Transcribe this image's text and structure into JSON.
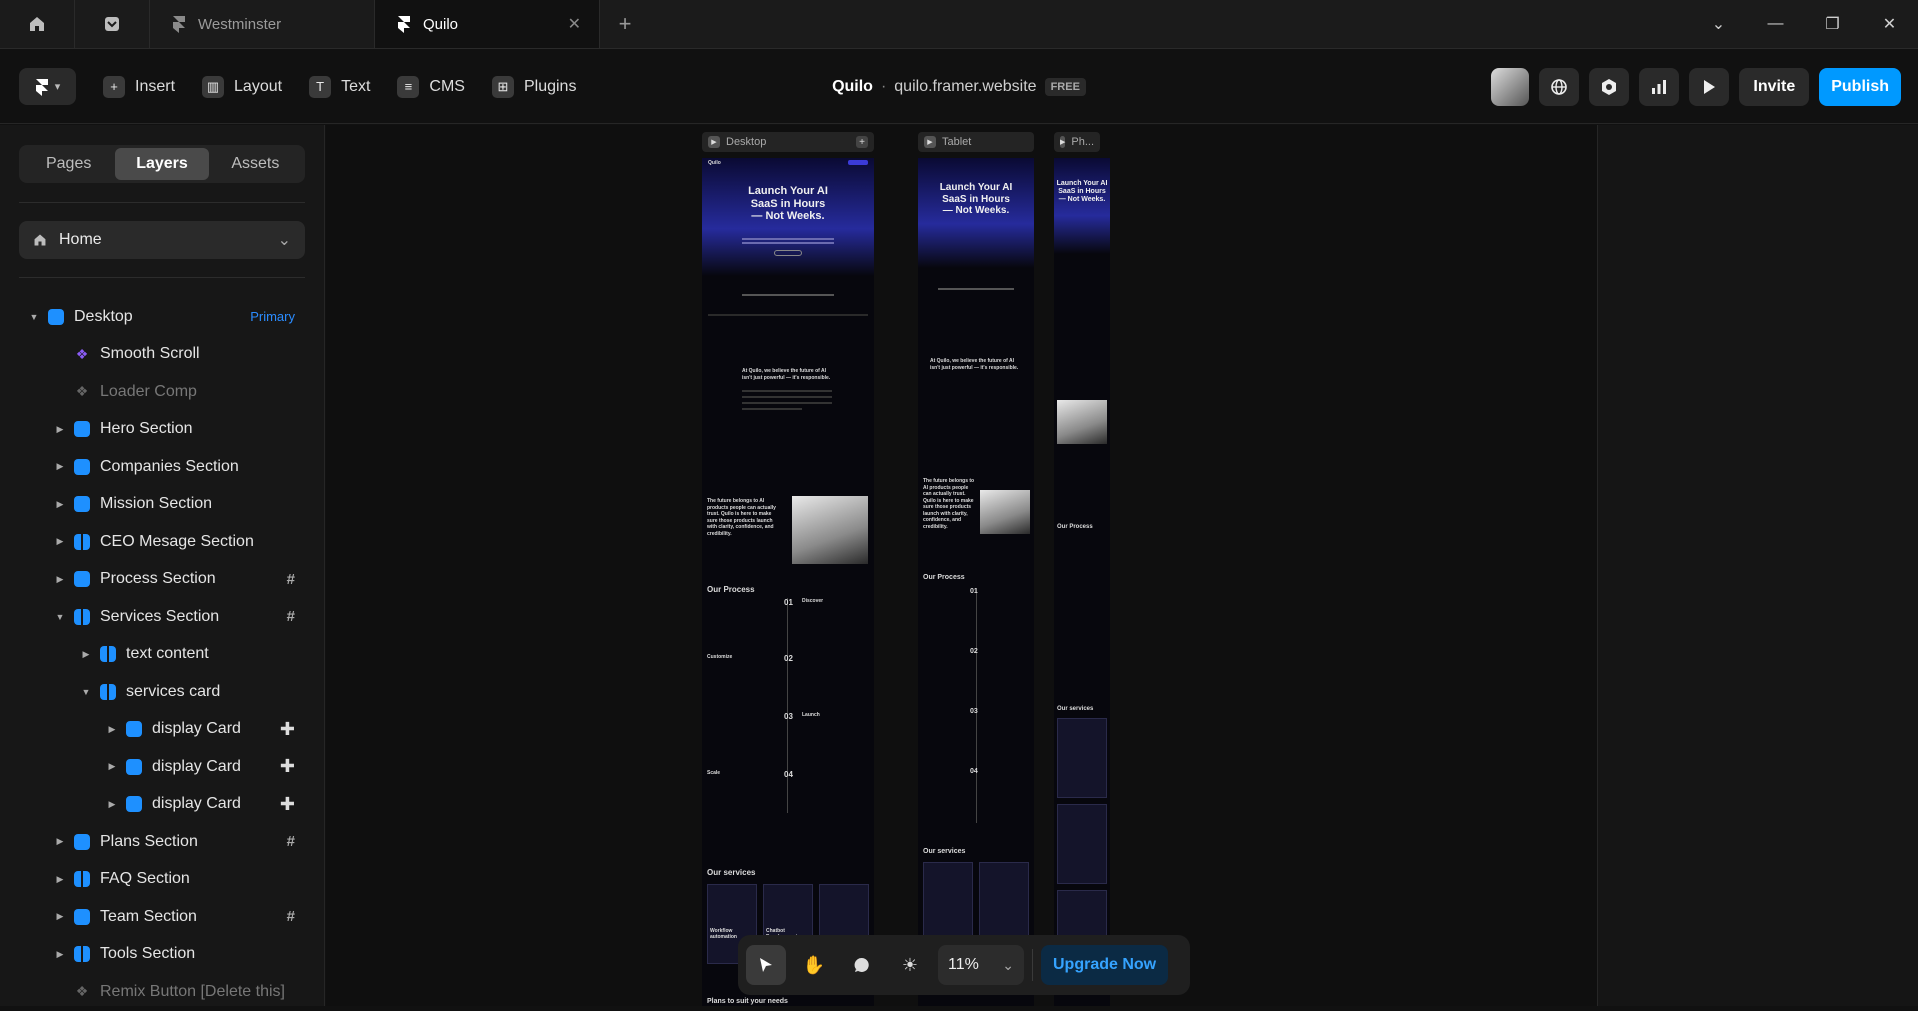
{
  "tabs": [
    {
      "label": "Westminster",
      "active": false
    },
    {
      "label": "Quilo",
      "active": true
    }
  ],
  "toolbar": {
    "insert": "Insert",
    "layout": "Layout",
    "text": "Text",
    "cms": "CMS",
    "plugins": "Plugins",
    "site_name": "Quilo",
    "separator": "·",
    "site_url": "quilo.framer.website",
    "plan_badge": "FREE",
    "invite": "Invite",
    "publish": "Publish"
  },
  "sidebar": {
    "tabs": [
      "Pages",
      "Layers",
      "Assets"
    ],
    "active_tab": "Layers",
    "page": "Home",
    "layers": [
      {
        "label": "Desktop",
        "depth": 0,
        "arrow": "open",
        "icon": "frame",
        "badge": "Primary"
      },
      {
        "label": "Smooth Scroll",
        "depth": 1,
        "arrow": "",
        "icon": "component"
      },
      {
        "label": "Loader Comp",
        "depth": 1,
        "arrow": "",
        "icon": "component-dim",
        "dim": true
      },
      {
        "label": "Hero Section",
        "depth": 1,
        "arrow": "closed",
        "icon": "frame"
      },
      {
        "label": "Companies Section",
        "depth": 1,
        "arrow": "closed",
        "icon": "frame"
      },
      {
        "label": "Mission Section",
        "depth": 1,
        "arrow": "closed",
        "icon": "frame"
      },
      {
        "label": "CEO Mesage Section",
        "depth": 1,
        "arrow": "closed",
        "icon": "stack"
      },
      {
        "label": "Process Section",
        "depth": 1,
        "arrow": "closed",
        "icon": "frame",
        "marker": "#"
      },
      {
        "label": "Services Section",
        "depth": 1,
        "arrow": "open",
        "icon": "grid",
        "marker": "#"
      },
      {
        "label": "text content",
        "depth": 2,
        "arrow": "closed",
        "icon": "stack"
      },
      {
        "label": "services card",
        "depth": 2,
        "arrow": "open",
        "icon": "grid"
      },
      {
        "label": "display Card",
        "depth": 3,
        "arrow": "closed",
        "icon": "frame",
        "marker": "+"
      },
      {
        "label": "display Card",
        "depth": 3,
        "arrow": "closed",
        "icon": "frame",
        "marker": "+"
      },
      {
        "label": "display Card",
        "depth": 3,
        "arrow": "closed",
        "icon": "frame",
        "marker": "+"
      },
      {
        "label": "Plans Section",
        "depth": 1,
        "arrow": "closed",
        "icon": "frame",
        "marker": "#"
      },
      {
        "label": "FAQ Section",
        "depth": 1,
        "arrow": "closed",
        "icon": "stack"
      },
      {
        "label": "Team Section",
        "depth": 1,
        "arrow": "closed",
        "icon": "frame",
        "marker": "#"
      },
      {
        "label": "Tools Section",
        "depth": 1,
        "arrow": "closed",
        "icon": "grid"
      },
      {
        "label": "Remix Button [Delete this]",
        "depth": 1,
        "arrow": "",
        "icon": "component-dim",
        "dim": true
      }
    ]
  },
  "canvas": {
    "frames": [
      {
        "label": "Desktop"
      },
      {
        "label": "Tablet"
      },
      {
        "label": "Ph..."
      }
    ],
    "preview": {
      "hero_title_1": "Launch Your AI",
      "hero_title_2": "SaaS in Hours",
      "hero_title_3": "— Not Weeks.",
      "mission": "At Quilo, we believe the future of AI isn't just powerful — it's responsible.",
      "ceo": "The future belongs to AI products people can actually trust. Quilo is here to make sure those products launch with clarity, confidence, and credibility.",
      "process_title": "Our Process",
      "steps": [
        {
          "num": "01",
          "name": "Discover"
        },
        {
          "num": "02",
          "name": "Customize"
        },
        {
          "num": "03",
          "name": "Launch"
        },
        {
          "num": "04",
          "name": "Scale"
        }
      ],
      "services_title": "Our services",
      "services_card_1": "Workflow automation",
      "services_card_2": "Chatbot Development",
      "plans_title": "Plans to suit your needs"
    }
  },
  "bottom_bar": {
    "zoom": "11%",
    "upgrade": "Upgrade Now"
  },
  "colors": {
    "accent": "#0099ff",
    "layer_icon": "#1e90ff",
    "component": "#8b5cf6"
  }
}
